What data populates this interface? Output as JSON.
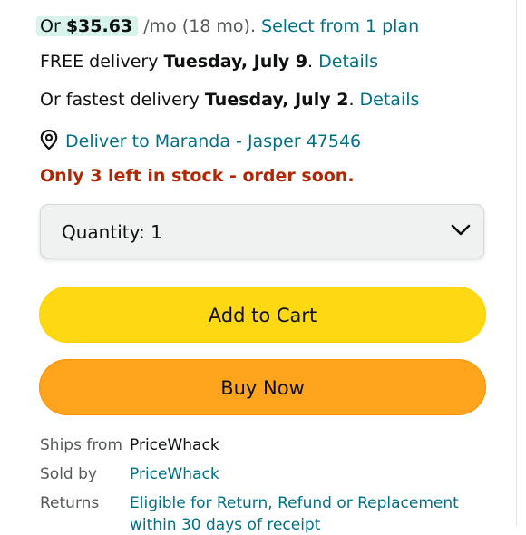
{
  "installment": {
    "prefix": "Or",
    "amount": "$35.63",
    "term": "/mo (18 mo).",
    "link": "Select from 1 plan"
  },
  "delivery": {
    "free_prefix": "FREE delivery",
    "free_date": "Tuesday, July 9",
    "free_link": "Details",
    "fast_prefix": "Or fastest delivery",
    "fast_date": "Tuesday, July 2",
    "fast_link": "Details",
    "deliver_to": "Deliver to Maranda - Jasper 47546"
  },
  "stock": {
    "message": "Only 3 left in stock - order soon."
  },
  "quantity": {
    "label": "Quantity:",
    "value": "1"
  },
  "buttons": {
    "add_to_cart": "Add to Cart",
    "buy_now": "Buy Now"
  },
  "info": {
    "ships_from_label": "Ships from",
    "ships_from_value": "PriceWhack",
    "sold_by_label": "Sold by",
    "sold_by_value": "PriceWhack",
    "returns_label": "Returns",
    "returns_value_line1": "Eligible for Return, Refund or Replacement",
    "returns_value_line2": "within 30 days of receipt"
  },
  "colors": {
    "link": "#007185",
    "stock_warning": "#b12704",
    "add_to_cart": "#ffd814",
    "buy_now": "#ffa41c",
    "price_badge": "#d7f3ec"
  },
  "icons": {
    "location": "location-pin-icon",
    "dropdown": "chevron-down-icon"
  }
}
